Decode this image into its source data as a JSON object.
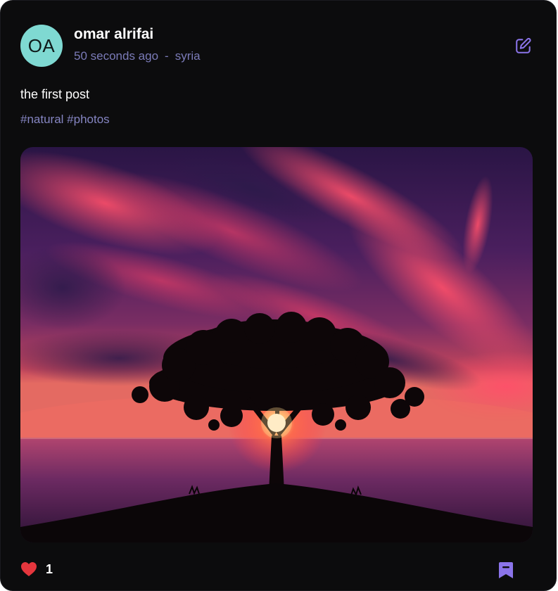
{
  "post": {
    "author": {
      "initials": "OA",
      "name": "omar alrifai",
      "avatar_color": "#7fd9d2"
    },
    "time_ago": "50 seconds ago",
    "separator": "-",
    "location": "syria",
    "text": "the first post",
    "tags": [
      "#natural",
      "#photos"
    ],
    "image": {
      "alt": "Silhouette of a tree on a hill in front of the sea at sunset under a red cloudy sky"
    },
    "likes": {
      "count": "1",
      "liked": true,
      "icon": "heart-icon",
      "color": "#e5363d"
    },
    "actions": {
      "edit_icon": "edit-icon",
      "bookmark_icon": "bookmark-icon"
    },
    "theme": {
      "background": "#0c0c0d",
      "accent": "#8b74ea",
      "muted_text": "#7b7bb8"
    }
  }
}
